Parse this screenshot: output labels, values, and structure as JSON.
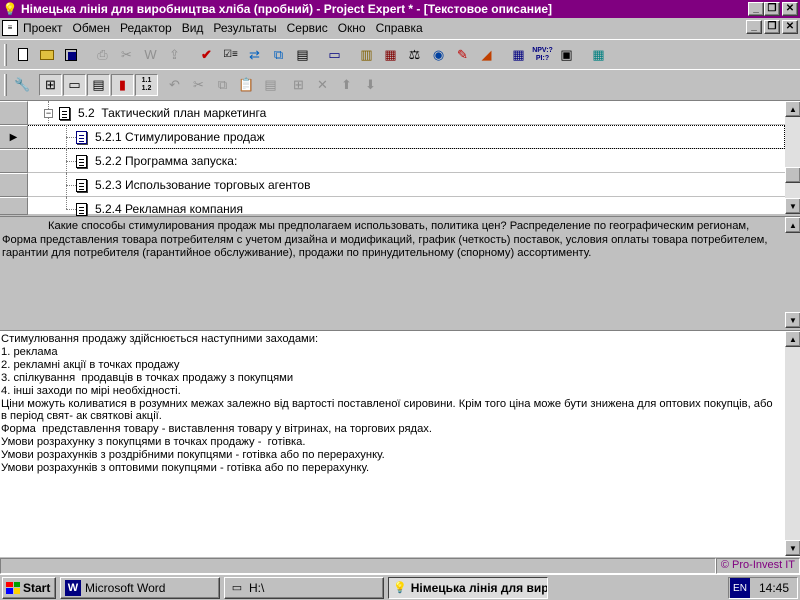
{
  "window": {
    "title": "Німецька лінія для виробництва хліба (пробний) - Project Expert * - [Текстовое описание]",
    "buttons": {
      "minimize": "_",
      "maximize": "❐",
      "close": "✕"
    }
  },
  "menu": {
    "items": [
      "Проект",
      "Обмен",
      "Редактор",
      "Вид",
      "Результаты",
      "Сервис",
      "Окно",
      "Справка"
    ]
  },
  "toolbar1": {
    "icons": [
      "new-icon",
      "open-icon",
      "save-icon",
      "print-icon",
      "cut-icon",
      "word-icon",
      "export-icon",
      "check-icon",
      "checklist-icon",
      "swap-icon",
      "copy-icon",
      "list-icon",
      "screen-icon",
      "calc-icon",
      "chart-icon",
      "scales-icon",
      "globe-icon",
      "report-icon",
      "graph-icon",
      "table-icon",
      "npv-pi-icon",
      "info-icon",
      "grid-icon"
    ],
    "npv_label": "NPV:?",
    "pi_label": "PI:?"
  },
  "toolbar2": {
    "level_label": "1.1",
    "level_label2": "1.2"
  },
  "tree": {
    "rows": [
      {
        "number": "5.2",
        "label": "Тактический план маркетинга",
        "level": 1,
        "expanded": true,
        "selected": false
      },
      {
        "number": "5.2.1",
        "label": "Стимулирование продаж",
        "level": 2,
        "selected": true
      },
      {
        "number": "5.2.2",
        "label": "Программа запуска:",
        "level": 2,
        "selected": false
      },
      {
        "number": "5.2.3",
        "label": "Использование торговых агентов",
        "level": 2,
        "selected": false
      },
      {
        "number": "5.2.4",
        "label": "Рекламная компания",
        "level": 2,
        "selected": false
      }
    ]
  },
  "description": {
    "text": "Какие способы стимулирования продаж мы предполагаем использовать, политика цен? Распределение по географическим регионам, Форма представления товара потребителям с учетом дизайна и модификаций, график (четкость) поставок, условия оплаты товара потребителем, гарантии для потребителя (гарантийное обслуживание), продажи по принудительному (спорному) ассортименту."
  },
  "editor": {
    "lines": [
      "Стимулювання продажу здійснюється наступними заходами:",
      "1. реклама",
      "2. рекламні акції в точках продажу",
      "3. спілкування  продавців в точках продажу з покупцями",
      "4. інші заходи по мірі необхідності.",
      "Ціни можуть коливатися в розумних межах залежно від вартості поставленої сировини. Крім того ціна може бути знижена для оптових покупців, або в період свят- ак святкові акції.",
      "Форма  представлення товару - виставлення товару у вітринах, на торгових рядах.",
      "Умови розрахунку з покупцями в точках продажу -  готівка.",
      "Умови розрахунків з роздрібними покупцями - готівка або по перерахунку.",
      "Умови розрахунків з оптовими покупцями - готівка або по перерахунку."
    ]
  },
  "statusbar": {
    "link": "© Pro-Invest IT"
  },
  "taskbar": {
    "start": "Start",
    "tasks": [
      {
        "label": "Microsoft Word",
        "icon": "word-icon",
        "active": false
      },
      {
        "label": "H:\\",
        "icon": "drive-icon",
        "active": false
      },
      {
        "label": "Німецька лінія для вир...",
        "icon": "bulb-icon",
        "active": true
      }
    ],
    "language": "EN",
    "clock": "14:45"
  }
}
